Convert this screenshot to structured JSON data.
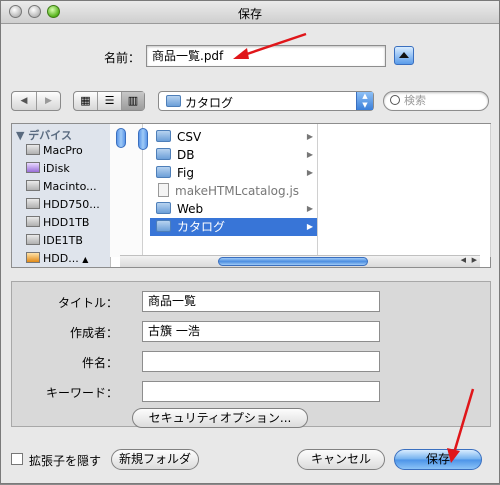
{
  "window": {
    "title": "保存"
  },
  "save_as": {
    "label": "名前：",
    "value": "商品一覧.pdf"
  },
  "toolbar": {
    "location": "カタログ",
    "search_placeholder": "検索"
  },
  "sidebar": {
    "header": "デバイス",
    "items": [
      "MacPro",
      "iDisk",
      "Macinto...",
      "HDD750...",
      "HDD1TB",
      "IDE1TB",
      "HDD..."
    ]
  },
  "browser": {
    "items": [
      {
        "name": "CSV",
        "kind": "folder",
        "selected": false
      },
      {
        "name": "DB",
        "kind": "folder",
        "selected": false
      },
      {
        "name": "Fig",
        "kind": "folder",
        "selected": false
      },
      {
        "name": "makeHTMLcatalog.js",
        "kind": "file",
        "selected": false
      },
      {
        "name": "Web",
        "kind": "folder",
        "selected": false
      },
      {
        "name": "カタログ",
        "kind": "folder",
        "selected": true
      }
    ]
  },
  "pdf_fields": {
    "title_label": "タイトル：",
    "title_value": "商品一覧",
    "author_label": "作成者：",
    "author_value": "古籏 一浩",
    "subject_label": "件名：",
    "subject_value": "",
    "keywords_label": "キーワード：",
    "keywords_value": "",
    "security_button": "セキュリティオプション..."
  },
  "footer": {
    "hide_extension": "拡張子を隠す",
    "new_folder": "新規フォルダ",
    "cancel": "キャンセル",
    "save": "保存"
  },
  "colors": {
    "selection": "#3875d7",
    "annotation_arrow": "#e0161a"
  }
}
